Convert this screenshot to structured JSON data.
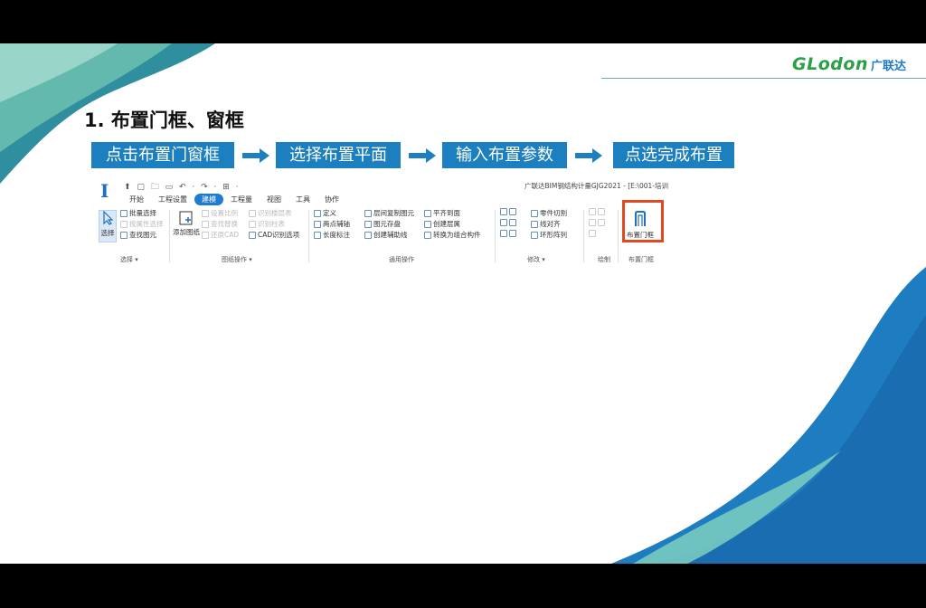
{
  "logo": {
    "en": "GLodon",
    "cn": "广联达"
  },
  "title": "1. 布置门框、窗框",
  "steps": [
    "点击布置门窗框",
    "选择布置平面",
    "输入布置参数",
    "点选完成布置"
  ],
  "ribbon": {
    "app_icon": "I",
    "qat": "⬆ ▢ 🗀 ▭ ↶ · ↷ · ⊞ ·",
    "app_title": "广联达BIM钢结构计量GJG2021 - [E:\\001-培训",
    "tabs": [
      "开始",
      "工程设置",
      "建模",
      "工程量",
      "视图",
      "工具",
      "协作"
    ],
    "active_tab": "建模",
    "groups": {
      "select": {
        "big": "选择",
        "items": [
          "批量选择",
          "按属性选择",
          "查找图元"
        ],
        "label": "选择 ▾"
      },
      "drawing": {
        "big": "添加图纸",
        "items_a": [
          "设置比例",
          "查找替换",
          "还原CAD"
        ],
        "items_b": [
          "识别楼层表",
          "识别柱表",
          "CAD识别选项"
        ],
        "label": "图纸操作 ▾"
      },
      "common": {
        "items": [
          "定义",
          "两点辅轴",
          "长度标注",
          "层间复制图元",
          "图元存盘",
          "创建辅助线",
          "平齐到面",
          "创建层属",
          "转换为组合构件"
        ],
        "label": "通用操作"
      },
      "modify": {
        "items": [
          "零件切割",
          "线对齐",
          "环形阵列"
        ],
        "label": "修改 ▾"
      },
      "draw": {
        "label": "绘制"
      },
      "door": {
        "big": "布置门框",
        "label": "布置门框"
      }
    }
  },
  "colors": {
    "step_bg": "#1c7fbf",
    "highlight": "#e04a22",
    "brand_green": "#2aa046",
    "brand_blue": "#1f7bc6"
  }
}
